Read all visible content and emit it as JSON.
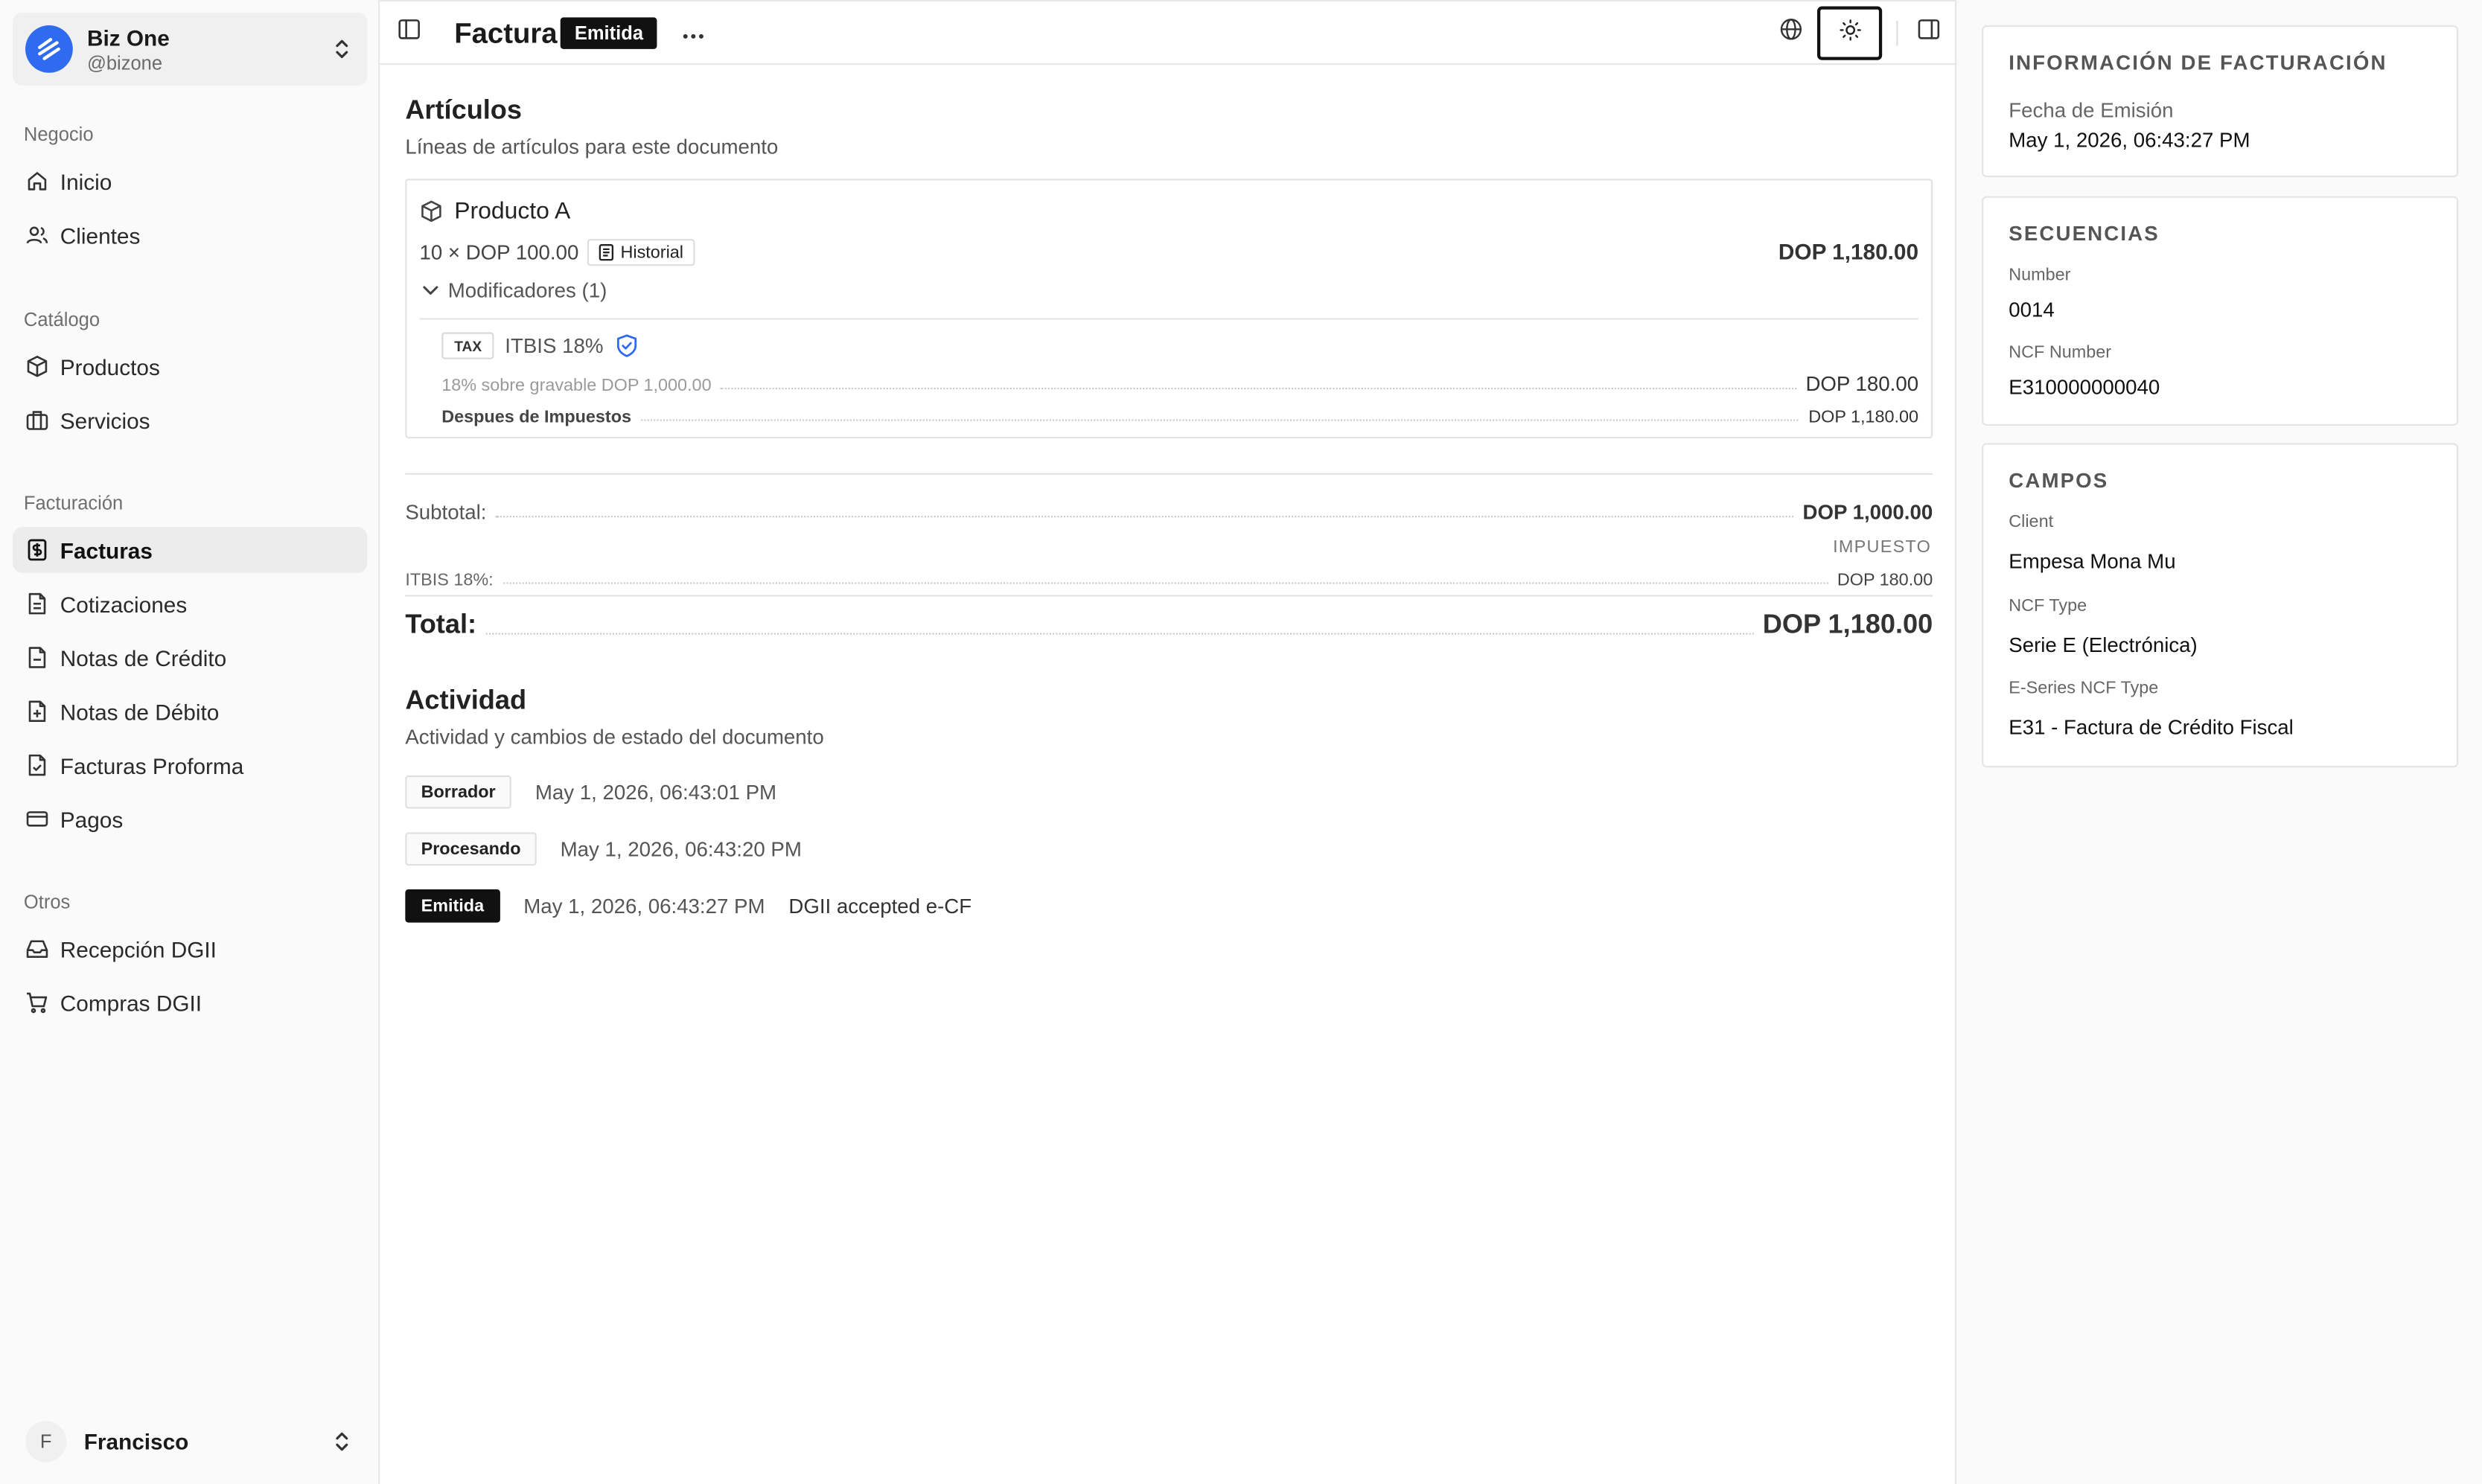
{
  "brand": {
    "name": "Biz One",
    "handle": "@bizone",
    "logo_color": "#2f6bf0"
  },
  "sidebar": {
    "groups": [
      {
        "label": "Negocio",
        "items": [
          {
            "label": "Inicio",
            "icon": "home-icon"
          },
          {
            "label": "Clientes",
            "icon": "users-icon"
          }
        ]
      },
      {
        "label": "Catálogo",
        "items": [
          {
            "label": "Productos",
            "icon": "package-icon"
          },
          {
            "label": "Servicios",
            "icon": "briefcase-icon"
          }
        ]
      },
      {
        "label": "Facturación",
        "items": [
          {
            "label": "Facturas",
            "icon": "receipt-icon",
            "active": true
          },
          {
            "label": "Cotizaciones",
            "icon": "file-text-icon"
          },
          {
            "label": "Notas de Crédito",
            "icon": "file-minus-icon"
          },
          {
            "label": "Notas de Débito",
            "icon": "file-plus-icon"
          },
          {
            "label": "Facturas Proforma",
            "icon": "file-check-icon"
          },
          {
            "label": "Pagos",
            "icon": "credit-card-icon"
          }
        ]
      },
      {
        "label": "Otros",
        "items": [
          {
            "label": "Recepción DGII",
            "icon": "inbox-icon"
          },
          {
            "label": "Compras DGII",
            "icon": "cart-icon"
          }
        ]
      }
    ]
  },
  "user": {
    "initial": "F",
    "name": "Francisco"
  },
  "header": {
    "title": "Factura",
    "status": "Emitida"
  },
  "items_section": {
    "title": "Artículos",
    "subtitle": "Líneas de artículos para este documento",
    "line": {
      "name": "Producto A",
      "qty_price": "10 × DOP 100.00",
      "history_label": "Historial",
      "total": "DOP 1,180.00",
      "modifiers_label": "Modificadores (1)",
      "tax_chip": "TAX",
      "tax_name": "ITBIS 18%",
      "tax_base_label": "18% sobre gravable DOP 1,000.00",
      "tax_amount": "DOP 180.00",
      "after_tax_label": "Despues de Impuestos",
      "after_tax_amount": "DOP 1,180.00"
    }
  },
  "summary": {
    "subtotal_label": "Subtotal:",
    "subtotal_value": "DOP 1,000.00",
    "tax_header": "IMPUESTO",
    "tax_label": "ITBIS 18%:",
    "tax_value": "DOP 180.00",
    "total_label": "Total:",
    "total_value": "DOP 1,180.00"
  },
  "activity": {
    "title": "Actividad",
    "subtitle": "Actividad y cambios de estado del documento",
    "events": [
      {
        "status": "Borrador",
        "date": "May 1, 2026, 06:43:01 PM",
        "note": ""
      },
      {
        "status": "Procesando",
        "date": "May 1, 2026, 06:43:20 PM",
        "note": ""
      },
      {
        "status": "Emitida",
        "date": "May 1, 2026, 06:43:27 PM",
        "note": "DGII accepted e-CF"
      }
    ]
  },
  "billing_info": {
    "title": "INFORMACIÓN DE FACTURACIÓN",
    "issue_label": "Fecha de Emisión",
    "issue_value": "May 1, 2026, 06:43:27 PM"
  },
  "sequences": {
    "title": "SECUENCIAS",
    "number_label": "Number",
    "number_value": "0014",
    "ncf_label": "NCF Number",
    "ncf_value": "E310000000040"
  },
  "fields": {
    "title": "CAMPOS",
    "client_label": "Client",
    "client_value": "Empesa Mona Mu",
    "ncf_type_label": "NCF Type",
    "ncf_type_value": "Serie E (Electrónica)",
    "eseries_label": "E-Series NCF Type",
    "eseries_value": "E31 - Factura de Crédito Fiscal"
  }
}
